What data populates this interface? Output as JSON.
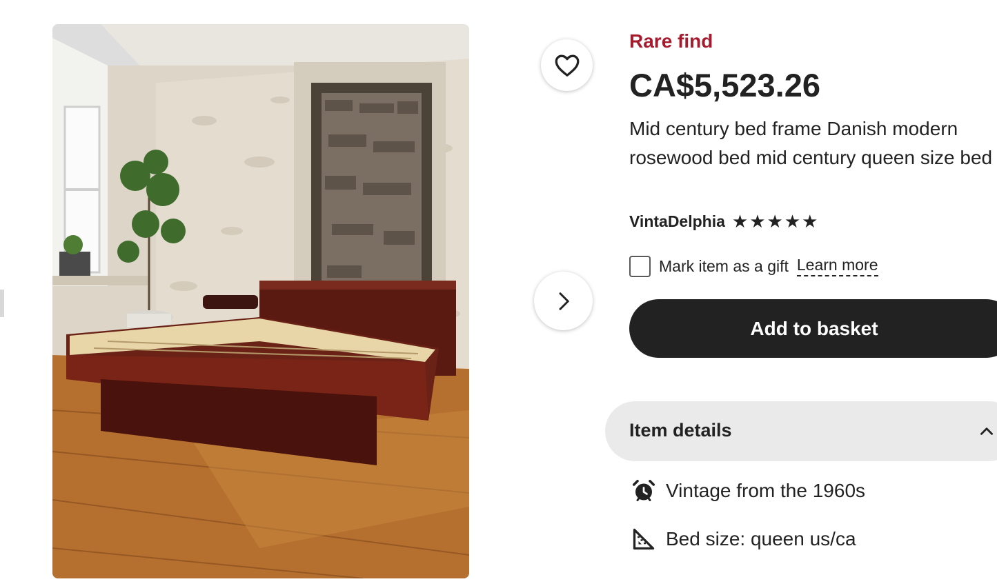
{
  "listing": {
    "badge": "Rare find",
    "price": "CA$5,523.26",
    "title": "Mid century bed frame Danish modern rosewood bed mid century queen size bed",
    "shop_name": "VintaDelphia",
    "rating_stars": 5,
    "gift_label": "Mark item as a gift",
    "gift_checked": false,
    "learn_more_label": "Learn more",
    "add_to_basket_label": "Add to basket"
  },
  "details": {
    "heading": "Item details",
    "expanded": true,
    "items": [
      {
        "icon": "alarm-clock-icon",
        "text": "Vintage from the 1960s"
      },
      {
        "icon": "ruler-triangle-icon",
        "text": "Bed size: queen us/ca"
      }
    ]
  },
  "gallery": {
    "image_subject": "rosewood platform bed in room with white stone walls",
    "favorite_icon": "heart-icon",
    "next_icon": "chevron-right-icon"
  },
  "colors": {
    "badge": "#a61a2e",
    "button": "#222222",
    "details_bar": "#eaeaea"
  }
}
